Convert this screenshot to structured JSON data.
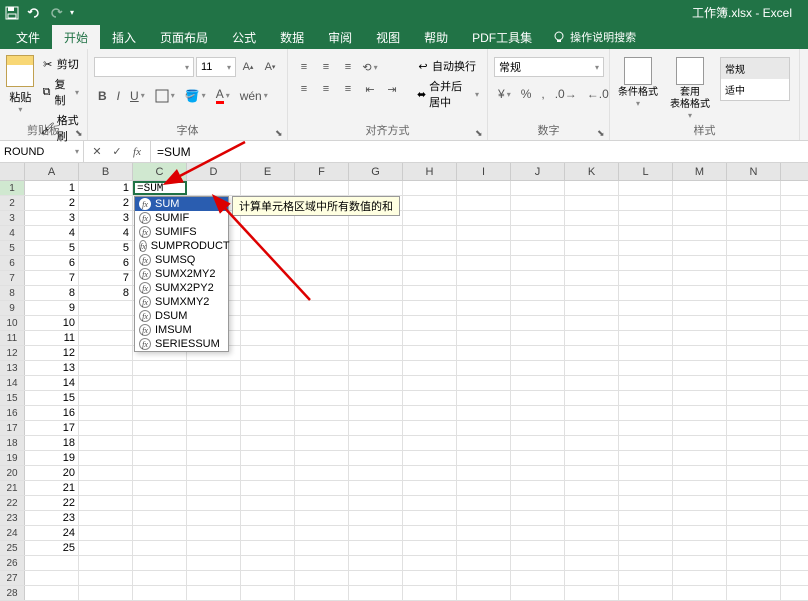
{
  "app": {
    "title": "工作簿.xlsx - Excel"
  },
  "qat": {
    "save": "💾",
    "undo": "↶",
    "redo": "↷"
  },
  "tabs": {
    "file": "文件",
    "home": "开始",
    "insert": "插入",
    "layout": "页面布局",
    "formulas": "公式",
    "data": "数据",
    "review": "审阅",
    "view": "视图",
    "help": "帮助",
    "pdf": "PDF工具集",
    "tell_me": "操作说明搜索"
  },
  "ribbon": {
    "clipboard": {
      "label": "剪贴板",
      "paste": "粘贴",
      "cut": "剪切",
      "copy": "复制",
      "painter": "格式刷"
    },
    "font": {
      "label": "字体",
      "family": "",
      "size": "11",
      "bold": "B",
      "italic": "I",
      "underline": "U",
      "inc": "A",
      "dec": "A"
    },
    "align": {
      "label": "对齐方式",
      "wrap": "自动换行",
      "merge": "合并后居中"
    },
    "number": {
      "label": "数字",
      "format": "常规"
    },
    "styles": {
      "label": "样式",
      "cond": "条件格式",
      "table": "套用\n表格格式",
      "normal": "常规",
      "bad": "适中"
    }
  },
  "namebox": "ROUND",
  "formula": "=SUM",
  "editing_cell": "=SUM",
  "columns": [
    "A",
    "B",
    "C",
    "D",
    "E",
    "F",
    "G",
    "H",
    "I",
    "J",
    "K",
    "L",
    "M",
    "N"
  ],
  "row_count": 28,
  "col_a_values": [
    1,
    2,
    3,
    4,
    5,
    6,
    7,
    8,
    9,
    10,
    11,
    12,
    13,
    14,
    15,
    16,
    17,
    18,
    19,
    20,
    21,
    22,
    23,
    24,
    25
  ],
  "col_b_values": [
    1,
    2,
    3,
    4,
    5,
    6,
    7,
    8
  ],
  "intellisense": {
    "items": [
      "SUM",
      "SUMIF",
      "SUMIFS",
      "SUMPRODUCT",
      "SUMSQ",
      "SUMX2MY2",
      "SUMX2PY2",
      "SUMXMY2",
      "DSUM",
      "IMSUM",
      "SERIESSUM"
    ],
    "selected_index": 0,
    "tooltip": "计算单元格区域中所有数值的和"
  }
}
